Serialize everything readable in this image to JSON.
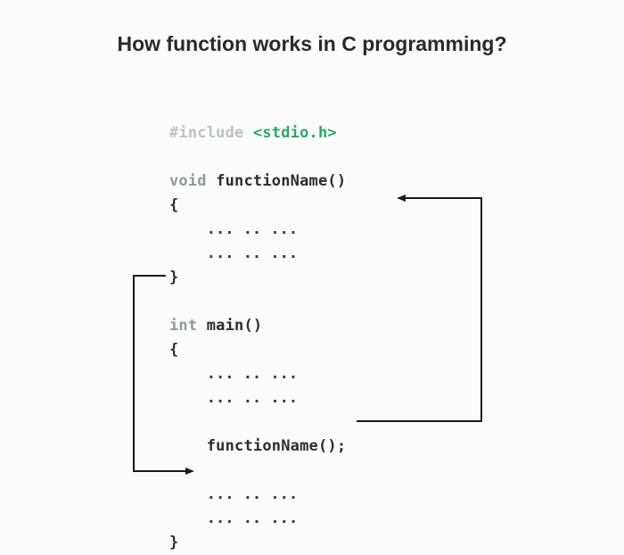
{
  "title": "How function works in C programming?",
  "code": {
    "include": {
      "directive": "#include",
      "lib": "<stdio.h>"
    },
    "fnDef": {
      "retType": "void",
      "name": "functionName",
      "parens": "()",
      "openBrace": "{",
      "body1": "... .. ...",
      "body2": "... .. ...",
      "closeBrace": "}"
    },
    "mainDef": {
      "retType": "int",
      "name": "main",
      "parens": "()",
      "openBrace": "{",
      "pre1": "... .. ...",
      "pre2": "... .. ...",
      "call": "functionName();",
      "post1": "... .. ...",
      "post2": "... .. ...",
      "closeBrace": "}"
    }
  }
}
